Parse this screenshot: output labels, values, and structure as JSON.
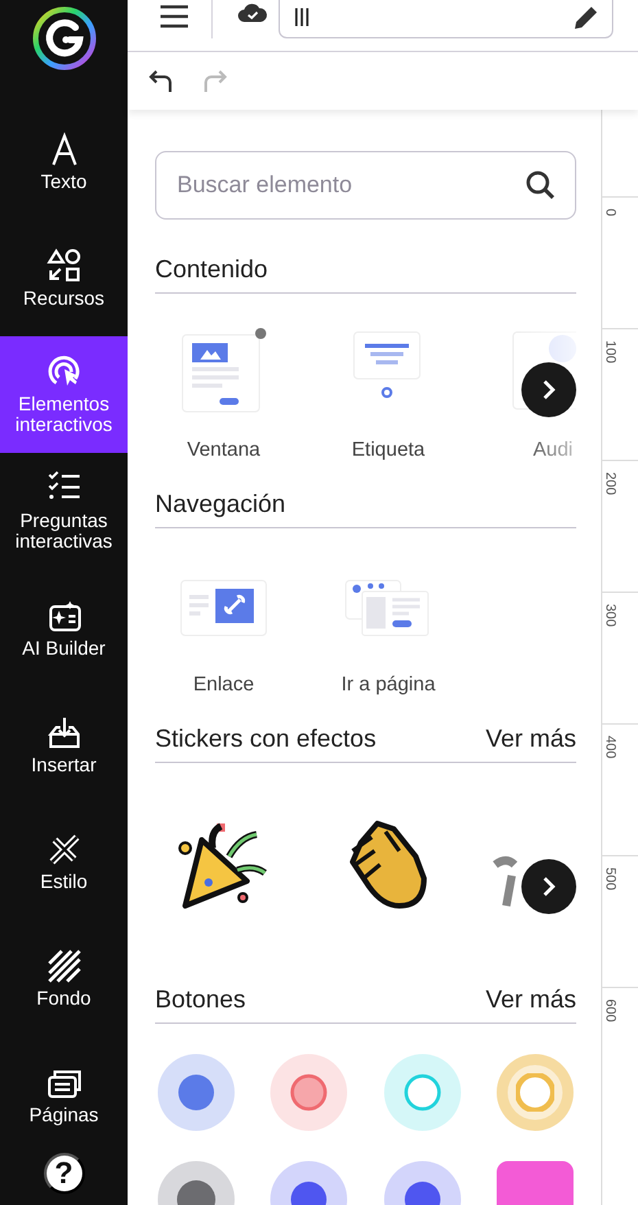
{
  "sidebar": {
    "items": [
      {
        "label": "Texto",
        "selected": false
      },
      {
        "label": "Recursos",
        "selected": false
      },
      {
        "label": "Elementos interactivos",
        "selected": true
      },
      {
        "label": "Preguntas interactivas",
        "selected": false
      },
      {
        "label": "AI Builder",
        "selected": false
      },
      {
        "label": "Insertar",
        "selected": false
      },
      {
        "label": "Estilo",
        "selected": false
      },
      {
        "label": "Fondo",
        "selected": false
      },
      {
        "label": "Páginas",
        "selected": false
      }
    ],
    "help": "?"
  },
  "header": {
    "title_value": "lll"
  },
  "search": {
    "placeholder": "Buscar elemento"
  },
  "sections": [
    {
      "title": "Contenido",
      "kind": "items",
      "items": [
        {
          "label": "Ventana",
          "kind": "window"
        },
        {
          "label": "Etiqueta",
          "kind": "label"
        },
        {
          "label": "Audi",
          "kind": "audio"
        }
      ],
      "carousel": true
    },
    {
      "title": "Navegación",
      "kind": "items",
      "items": [
        {
          "label": "Enlace",
          "kind": "link"
        },
        {
          "label": "Ir a página",
          "kind": "page"
        }
      ],
      "carousel": false
    },
    {
      "title": "Stickers con efectos",
      "link": "Ver más",
      "kind": "stickers",
      "items": [
        {
          "kind": "party"
        },
        {
          "kind": "clap"
        },
        {
          "kind": "ribbon"
        }
      ],
      "carousel": true
    },
    {
      "title": "Botones",
      "link": "Ver más",
      "kind": "buttons",
      "items": [
        {
          "kind": "dot",
          "color": "#5b7be8"
        },
        {
          "kind": "ring",
          "color": "#ef6a70"
        },
        {
          "kind": "ring",
          "color": "#22d3dc"
        },
        {
          "kind": "halo",
          "color": "#f0bd4e"
        },
        {
          "kind": "grey",
          "color": "#6c6c70"
        },
        {
          "kind": "dot",
          "color": "#4f56f0"
        },
        {
          "kind": "dot",
          "color": "#4f56f0"
        },
        {
          "kind": "square",
          "color": "#f35bd6"
        }
      ]
    }
  ],
  "ruler": {
    "marks": [
      "0",
      "100",
      "200",
      "300",
      "400",
      "500",
      "600"
    ]
  }
}
